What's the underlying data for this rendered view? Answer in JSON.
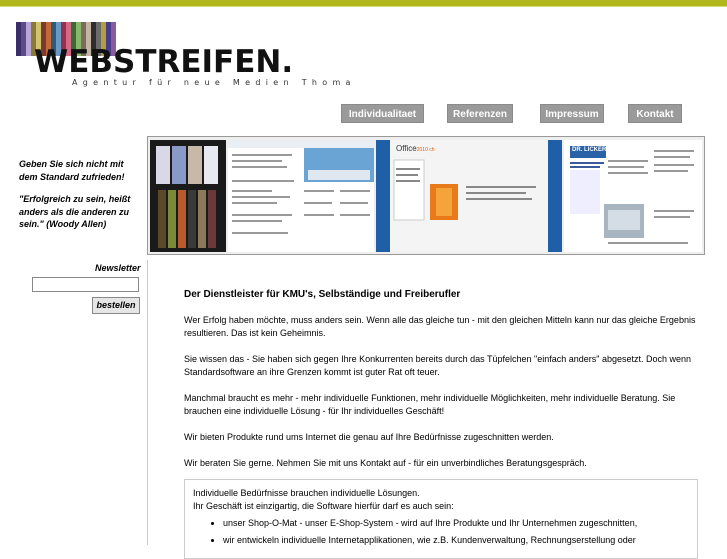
{
  "logo": {
    "wordmark": "WEBSTREIFEN.",
    "tagline": "Agentur für neue Medien Thoma",
    "stripe_colors": [
      "#3b2e6b",
      "#5b4b8a",
      "#b8a6d4",
      "#8a7a3a",
      "#d4c36e",
      "#7a3b2e",
      "#c46a3a",
      "#2e5b7a",
      "#6a9ac4",
      "#9a2e4b",
      "#d46a8a",
      "#3b6b2e",
      "#8ab86a",
      "#7a6b5b",
      "#c4b4a4",
      "#2e2e2e",
      "#6b6b6b",
      "#b0a040",
      "#4b3b8a",
      "#8a5b9a"
    ]
  },
  "nav": {
    "items": [
      {
        "label": "Individualitaet"
      },
      {
        "label": "Referenzen"
      },
      {
        "label": "Impressum"
      },
      {
        "label": "Kontakt"
      }
    ]
  },
  "sidebar": {
    "intro": "Geben Sie sich nicht mit dem Standard zufrieden!",
    "quote": "\"Erfolgreich zu sein, heißt anders als die anderen zu sein.\" (Woody Allen)",
    "newsletter_label": "Newsletter",
    "newsletter_input_value": "",
    "newsletter_button": "bestellen"
  },
  "banner": {
    "office_label": "Office",
    "office_year": "2010 ch",
    "company_label": "DR. LICKERT"
  },
  "main": {
    "heading": "Der Dienstleister für KMU's, Selbständige und Freiberufler",
    "paragraphs": [
      "Wer Erfolg haben möchte, muss anders sein. Wenn alle das gleiche tun - mit den gleichen Mitteln kann nur das gleiche Ergebnis resultieren. Das ist kein Geheimnis.",
      "Sie wissen das - Sie haben sich gegen Ihre Konkurrenten bereits durch das Tüpfelchen \"einfach anders\" abgesetzt. Doch wenn Standardsoftware an ihre Grenzen kommt ist guter Rat oft teuer.",
      "Manchmal braucht es mehr - mehr individuelle Funktionen, mehr individuelle Möglichkeiten, mehr individuelle Beratung. Sie brauchen eine individuelle Lösung - für Ihr individuelles Geschäft!",
      "Wir bieten Produkte rund ums Internet die genau auf Ihre Bedürfnisse zugeschnitten werden.",
      "Wir beraten Sie gerne. Nehmen Sie mit uns Kontakt auf - für ein unverbindliches Beratungsgespräch."
    ],
    "box": {
      "line1": "Individuelle Bedürfnisse brauchen individuelle Lösungen.",
      "line2": "Ihr Geschäft ist einzigartig, die Software hierfür darf es auch sein:",
      "bullets": [
        "unser Shop-O-Mat - unser E-Shop-System - wird auf Ihre Produkte und Ihr Unternehmen zugeschnitten,",
        "wir entwickeln individuelle Internetapplikationen, wie z.B. Kundenverwaltung, Rechnungserstellung oder"
      ]
    }
  }
}
